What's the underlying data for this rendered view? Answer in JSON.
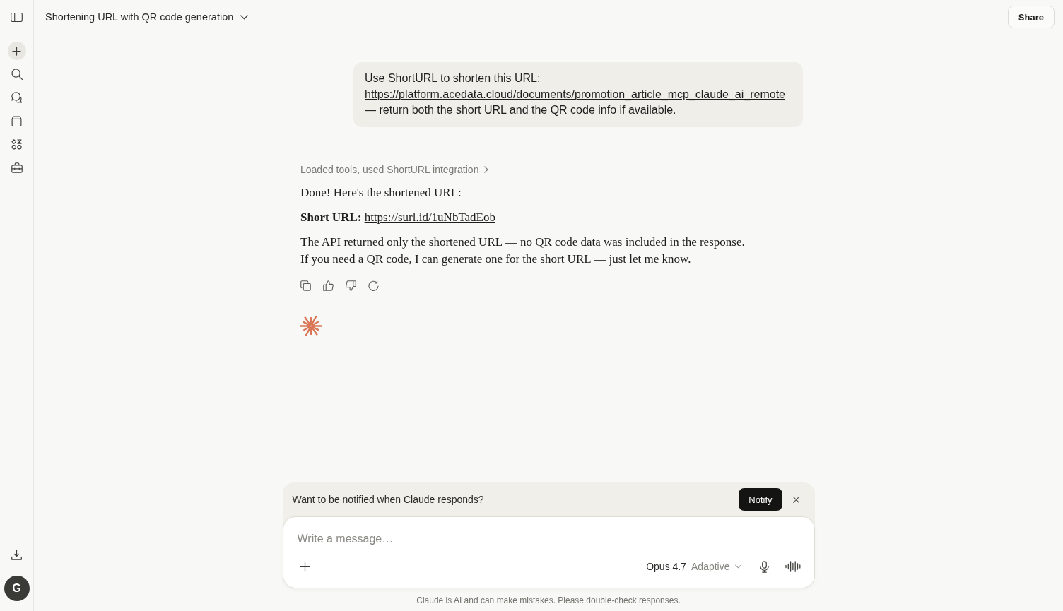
{
  "header": {
    "title": "Shortening URL with QR code generation",
    "share_label": "Share"
  },
  "sidebar": {
    "avatar_initial": "G"
  },
  "user_message": {
    "text_before": "Use ShortURL to shorten this URL:",
    "link": "https://platform.acedata.cloud/documents/promotion_article_mcp_claude_ai_remote",
    "text_after": "— return both the short URL and the QR code info if available."
  },
  "assistant_message": {
    "tool_summary": "Loaded tools, used ShortURL integration",
    "paragraphs": [
      {
        "kind": "text",
        "lines": [
          "Done! Here's the shortened URL:"
        ]
      },
      {
        "kind": "link_line",
        "label": "Short URL:",
        "link": "https://surl.id/1uNbTadEob"
      },
      {
        "kind": "text",
        "lines": [
          "The API returned only the shortened URL — no QR code data was included in the response.",
          "If you need a QR code, I can generate one for the short URL — just let me know."
        ]
      }
    ]
  },
  "notification": {
    "text": "Want to be notified when Claude responds?",
    "button_label": "Notify"
  },
  "composer": {
    "placeholder": "Write a message…",
    "model": "Opus 4.7",
    "mode": "Adaptive"
  },
  "disclaimer": "Claude is AI and can make mistakes. Please double-check responses."
}
